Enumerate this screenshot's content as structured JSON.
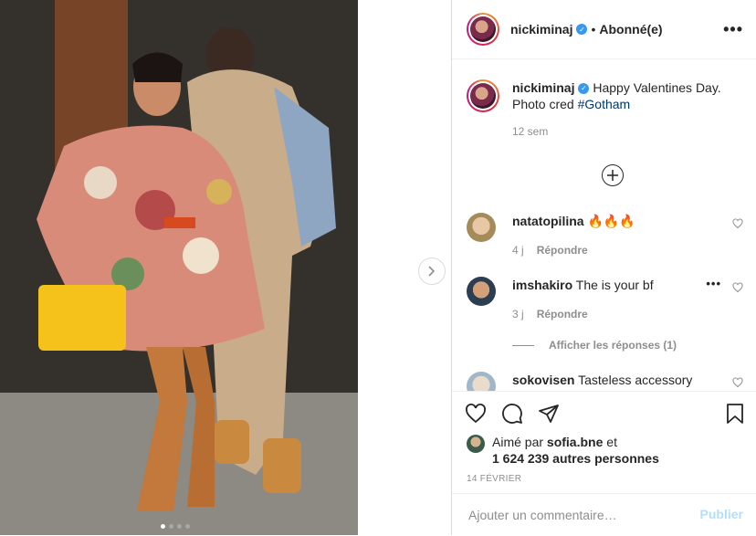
{
  "post": {
    "username": "nickiminaj",
    "separator": "•",
    "follow_status": "Abonné(e)",
    "more_glyph": "•••"
  },
  "caption": {
    "username": "nickiminaj",
    "text": "Happy Valentines Day. Photo cred ",
    "hashtag": "#Gotham",
    "time": "12 sem"
  },
  "comments": [
    {
      "username": "natatopilina",
      "text": "🔥🔥🔥",
      "time": "4 j",
      "reply": "Répondre"
    },
    {
      "username": "imshakiro",
      "text": "The is your bf",
      "time": "3 j",
      "reply": "Répondre"
    },
    {
      "username": "sokovisen",
      "text": "Tasteless accessory"
    }
  ],
  "view_replies": "Afficher les réponses (1)",
  "likes": {
    "prefix": "Aimé par ",
    "user": "sofia.bne",
    "conj": " et",
    "count": "1 624 239 autres personnes"
  },
  "date": "14 FÉVRIER",
  "comment_box": {
    "placeholder": "Ajouter un commentaire…",
    "publish": "Publier"
  },
  "carousel": {
    "total": 4,
    "active": 1
  }
}
